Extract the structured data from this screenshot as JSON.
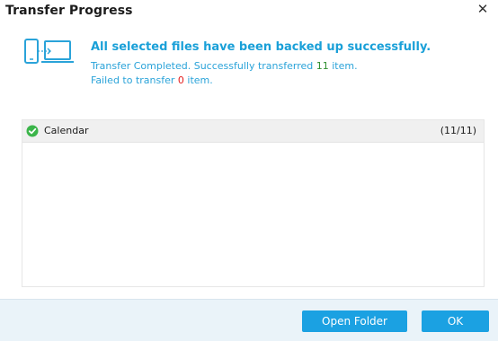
{
  "window": {
    "title": "Transfer Progress",
    "close_glyph": "✕"
  },
  "status": {
    "icon": "device-transfer-icon",
    "headline": "All selected files have been backed up successfully.",
    "completed_prefix": "Transfer Completed. Successfully transferred ",
    "success_count": "11",
    "completed_suffix": " item.",
    "failed_prefix": "Failed to transfer ",
    "failed_count": "0",
    "failed_suffix": " item."
  },
  "list": {
    "items": [
      {
        "label": "Calendar",
        "count": "(11/11)",
        "icon": "check-circle-icon"
      }
    ]
  },
  "footer": {
    "open_folder_label": "Open Folder",
    "ok_label": "OK"
  },
  "colors": {
    "accent": "#1ba1e2",
    "success": "#2f8f2f",
    "failure": "#e41e1e",
    "footer_bg": "#eaf3f9"
  }
}
